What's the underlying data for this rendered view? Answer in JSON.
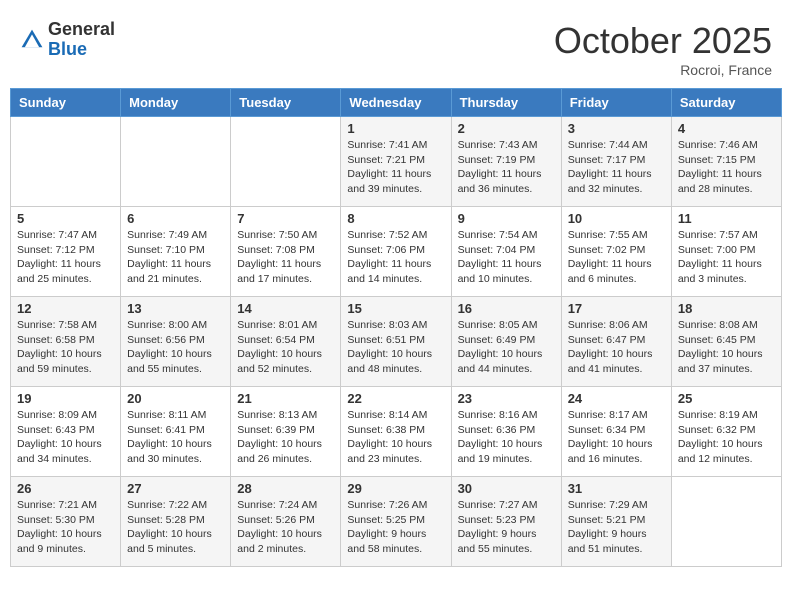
{
  "header": {
    "logo_general": "General",
    "logo_blue": "Blue",
    "month_title": "October 2025",
    "location": "Rocroi, France"
  },
  "days_of_week": [
    "Sunday",
    "Monday",
    "Tuesday",
    "Wednesday",
    "Thursday",
    "Friday",
    "Saturday"
  ],
  "weeks": [
    [
      {
        "day": "",
        "info": ""
      },
      {
        "day": "",
        "info": ""
      },
      {
        "day": "",
        "info": ""
      },
      {
        "day": "1",
        "info": "Sunrise: 7:41 AM\nSunset: 7:21 PM\nDaylight: 11 hours\nand 39 minutes."
      },
      {
        "day": "2",
        "info": "Sunrise: 7:43 AM\nSunset: 7:19 PM\nDaylight: 11 hours\nand 36 minutes."
      },
      {
        "day": "3",
        "info": "Sunrise: 7:44 AM\nSunset: 7:17 PM\nDaylight: 11 hours\nand 32 minutes."
      },
      {
        "day": "4",
        "info": "Sunrise: 7:46 AM\nSunset: 7:15 PM\nDaylight: 11 hours\nand 28 minutes."
      }
    ],
    [
      {
        "day": "5",
        "info": "Sunrise: 7:47 AM\nSunset: 7:12 PM\nDaylight: 11 hours\nand 25 minutes."
      },
      {
        "day": "6",
        "info": "Sunrise: 7:49 AM\nSunset: 7:10 PM\nDaylight: 11 hours\nand 21 minutes."
      },
      {
        "day": "7",
        "info": "Sunrise: 7:50 AM\nSunset: 7:08 PM\nDaylight: 11 hours\nand 17 minutes."
      },
      {
        "day": "8",
        "info": "Sunrise: 7:52 AM\nSunset: 7:06 PM\nDaylight: 11 hours\nand 14 minutes."
      },
      {
        "day": "9",
        "info": "Sunrise: 7:54 AM\nSunset: 7:04 PM\nDaylight: 11 hours\nand 10 minutes."
      },
      {
        "day": "10",
        "info": "Sunrise: 7:55 AM\nSunset: 7:02 PM\nDaylight: 11 hours\nand 6 minutes."
      },
      {
        "day": "11",
        "info": "Sunrise: 7:57 AM\nSunset: 7:00 PM\nDaylight: 11 hours\nand 3 minutes."
      }
    ],
    [
      {
        "day": "12",
        "info": "Sunrise: 7:58 AM\nSunset: 6:58 PM\nDaylight: 10 hours\nand 59 minutes."
      },
      {
        "day": "13",
        "info": "Sunrise: 8:00 AM\nSunset: 6:56 PM\nDaylight: 10 hours\nand 55 minutes."
      },
      {
        "day": "14",
        "info": "Sunrise: 8:01 AM\nSunset: 6:54 PM\nDaylight: 10 hours\nand 52 minutes."
      },
      {
        "day": "15",
        "info": "Sunrise: 8:03 AM\nSunset: 6:51 PM\nDaylight: 10 hours\nand 48 minutes."
      },
      {
        "day": "16",
        "info": "Sunrise: 8:05 AM\nSunset: 6:49 PM\nDaylight: 10 hours\nand 44 minutes."
      },
      {
        "day": "17",
        "info": "Sunrise: 8:06 AM\nSunset: 6:47 PM\nDaylight: 10 hours\nand 41 minutes."
      },
      {
        "day": "18",
        "info": "Sunrise: 8:08 AM\nSunset: 6:45 PM\nDaylight: 10 hours\nand 37 minutes."
      }
    ],
    [
      {
        "day": "19",
        "info": "Sunrise: 8:09 AM\nSunset: 6:43 PM\nDaylight: 10 hours\nand 34 minutes."
      },
      {
        "day": "20",
        "info": "Sunrise: 8:11 AM\nSunset: 6:41 PM\nDaylight: 10 hours\nand 30 minutes."
      },
      {
        "day": "21",
        "info": "Sunrise: 8:13 AM\nSunset: 6:39 PM\nDaylight: 10 hours\nand 26 minutes."
      },
      {
        "day": "22",
        "info": "Sunrise: 8:14 AM\nSunset: 6:38 PM\nDaylight: 10 hours\nand 23 minutes."
      },
      {
        "day": "23",
        "info": "Sunrise: 8:16 AM\nSunset: 6:36 PM\nDaylight: 10 hours\nand 19 minutes."
      },
      {
        "day": "24",
        "info": "Sunrise: 8:17 AM\nSunset: 6:34 PM\nDaylight: 10 hours\nand 16 minutes."
      },
      {
        "day": "25",
        "info": "Sunrise: 8:19 AM\nSunset: 6:32 PM\nDaylight: 10 hours\nand 12 minutes."
      }
    ],
    [
      {
        "day": "26",
        "info": "Sunrise: 7:21 AM\nSunset: 5:30 PM\nDaylight: 10 hours\nand 9 minutes."
      },
      {
        "day": "27",
        "info": "Sunrise: 7:22 AM\nSunset: 5:28 PM\nDaylight: 10 hours\nand 5 minutes."
      },
      {
        "day": "28",
        "info": "Sunrise: 7:24 AM\nSunset: 5:26 PM\nDaylight: 10 hours\nand 2 minutes."
      },
      {
        "day": "29",
        "info": "Sunrise: 7:26 AM\nSunset: 5:25 PM\nDaylight: 9 hours\nand 58 minutes."
      },
      {
        "day": "30",
        "info": "Sunrise: 7:27 AM\nSunset: 5:23 PM\nDaylight: 9 hours\nand 55 minutes."
      },
      {
        "day": "31",
        "info": "Sunrise: 7:29 AM\nSunset: 5:21 PM\nDaylight: 9 hours\nand 51 minutes."
      },
      {
        "day": "",
        "info": ""
      }
    ]
  ]
}
